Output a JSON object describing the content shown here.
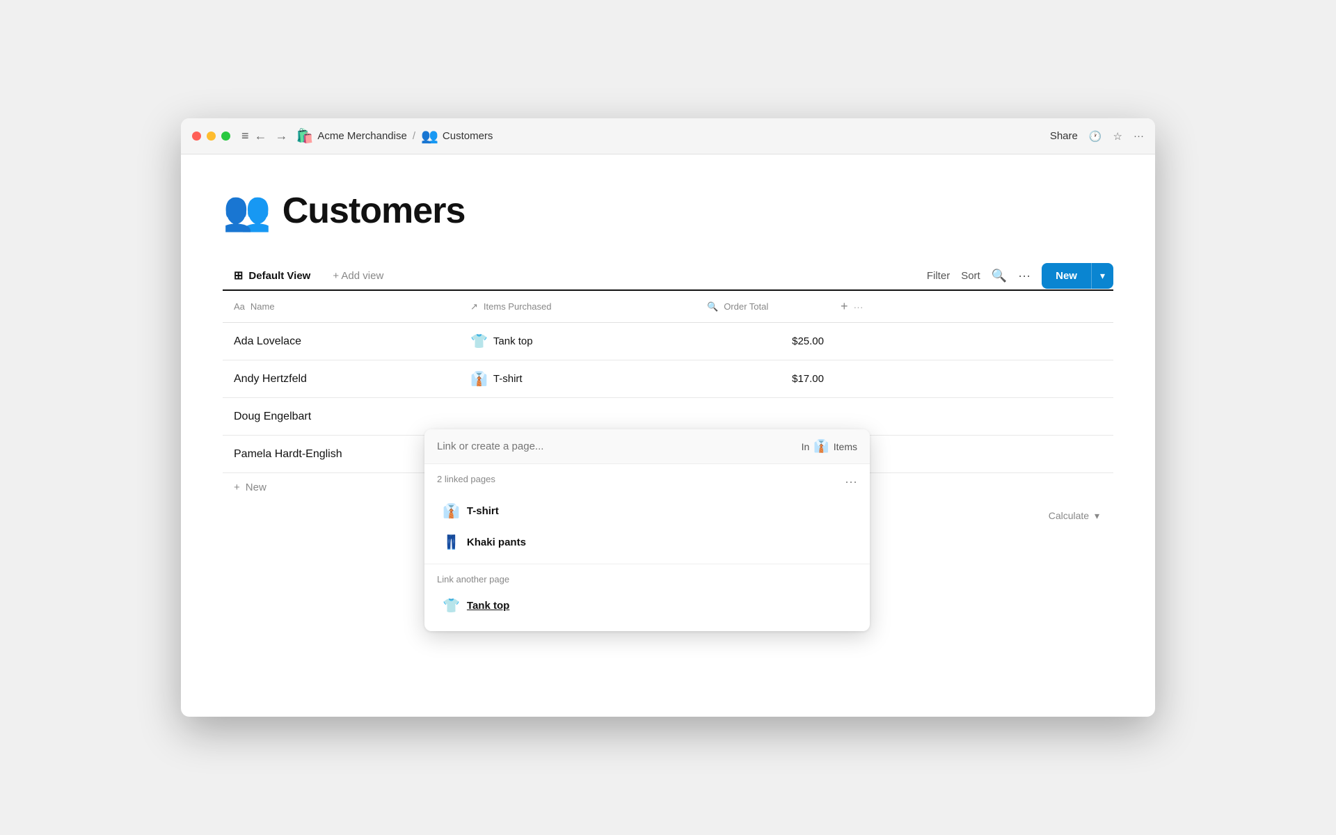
{
  "window": {
    "title": "Acme Merchandise / Customers"
  },
  "titlebar": {
    "breadcrumb": [
      {
        "emoji": "🛍️",
        "label": "Acme Merchandise"
      },
      {
        "emoji": "👥",
        "label": "Customers"
      }
    ],
    "share_label": "Share",
    "actions": [
      "clock",
      "star",
      "ellipsis"
    ]
  },
  "page": {
    "emoji": "👥",
    "title": "Customers"
  },
  "toolbar": {
    "view_icon": "⊞",
    "view_label": "Default View",
    "add_view_label": "+ Add view",
    "filter_label": "Filter",
    "sort_label": "Sort",
    "search_icon": "🔍",
    "more_icon": "···",
    "new_label": "New",
    "arrow_label": "▾"
  },
  "table": {
    "headers": [
      {
        "icon": "Aa",
        "label": "Name"
      },
      {
        "icon": "↗",
        "label": "Items Purchased"
      },
      {
        "icon": "🔍",
        "label": "Order Total"
      }
    ],
    "rows": [
      {
        "name": "Ada Lovelace",
        "item_emoji": "👕",
        "item": "Tank top",
        "order": "$25.00"
      },
      {
        "name": "Andy Hertzfeld",
        "item_emoji": "👔",
        "item": "T-shirt",
        "order": "$17.00"
      },
      {
        "name": "Doug Engelbart",
        "item_emoji": "",
        "item": "",
        "order": ""
      },
      {
        "name": "Pamela Hardt-English",
        "item_emoji": "",
        "item": "",
        "order": ""
      }
    ],
    "new_row_label": "New",
    "calculate_label": "Calculate"
  },
  "dropdown": {
    "search_placeholder": "Link or create a page...",
    "in_label": "In",
    "in_emoji": "👔",
    "in_text": "Items",
    "linked_pages_title": "2 linked pages",
    "linked_pages": [
      {
        "emoji": "👔",
        "label": "T-shirt"
      },
      {
        "emoji": "👖",
        "label": "Khaki pants"
      }
    ],
    "link_another_label": "Link another page",
    "suggestion_emoji": "👕",
    "suggestion_label": "Tank top"
  }
}
